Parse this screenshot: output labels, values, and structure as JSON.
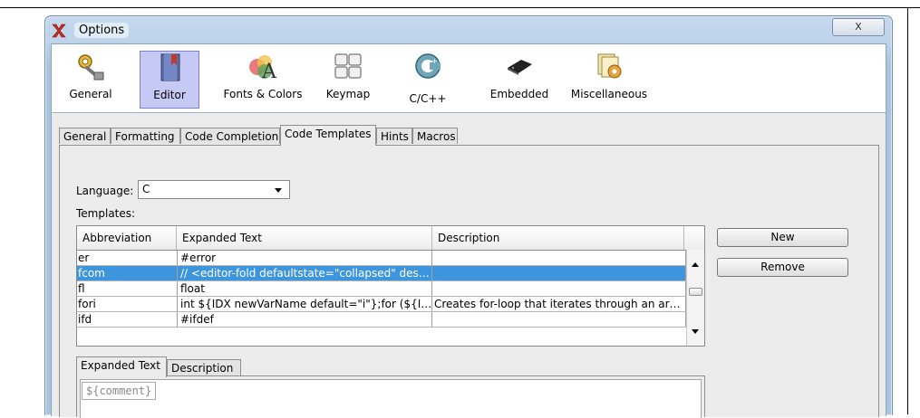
{
  "window": {
    "title": "Options",
    "close_glyph": "X"
  },
  "categories": [
    {
      "label": "General",
      "icon": "gears-icon",
      "selected": false
    },
    {
      "label": "Editor",
      "icon": "book-icon",
      "selected": true
    },
    {
      "label": "Fonts & Colors",
      "icon": "font-colors-icon",
      "selected": false
    },
    {
      "label": "Keymap",
      "icon": "keyboard-icon",
      "selected": false
    },
    {
      "label": "C/C++",
      "icon": "c-logo-icon",
      "selected": false
    },
    {
      "label": "Embedded",
      "icon": "chip-icon",
      "selected": false
    },
    {
      "label": "Miscellaneous",
      "icon": "misc-icon",
      "selected": false
    }
  ],
  "editor_tabs": [
    {
      "label": "General"
    },
    {
      "label": "Formatting"
    },
    {
      "label": "Code Completion"
    },
    {
      "label": "Code Templates",
      "active": true
    },
    {
      "label": "Hints"
    },
    {
      "label": "Macros"
    }
  ],
  "language": {
    "label": "Language:",
    "value": "C"
  },
  "templates": {
    "label": "Templates:",
    "columns": [
      "Abbreviation",
      "Expanded Text",
      "Description"
    ],
    "rows": [
      {
        "abbr": "er",
        "expanded": "#error",
        "description": ""
      },
      {
        "abbr": "fcom",
        "expanded": "// <editor-fold defaultstate=\"collapsed\" des…",
        "description": "",
        "selected": true
      },
      {
        "abbr": "fl",
        "expanded": "float",
        "description": ""
      },
      {
        "abbr": "fori",
        "expanded": "int ${IDX newVarName default=\"i\"};for (${I…",
        "description": "Creates for-loop that iterates through an ar…"
      },
      {
        "abbr": "ifd",
        "expanded": "#ifdef",
        "description": ""
      }
    ]
  },
  "buttons": {
    "new": "New",
    "remove": "Remove"
  },
  "detail_tabs": [
    {
      "label": "Expanded Text",
      "active": true
    },
    {
      "label": "Description"
    }
  ],
  "expanded_text": "${comment}",
  "colors": {
    "selection": "#3d95de",
    "category_selected": "#c6c9f3"
  }
}
